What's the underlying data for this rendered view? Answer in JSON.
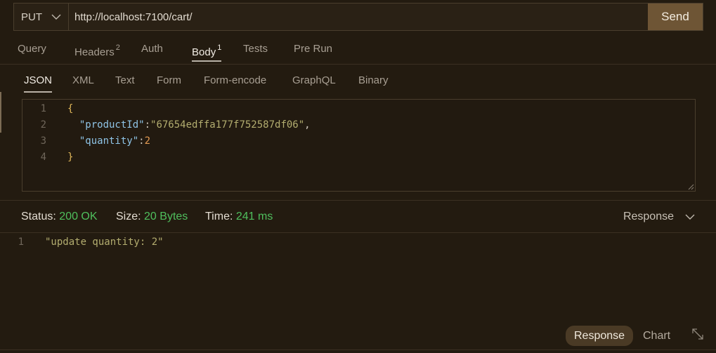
{
  "request": {
    "method": "PUT",
    "url": "http://localhost:7100/cart/",
    "send_label": "Send"
  },
  "request_tabs": [
    {
      "label": "Query",
      "badge": ""
    },
    {
      "label": "Headers",
      "badge": "2"
    },
    {
      "label": "Auth",
      "badge": ""
    },
    {
      "label": "Body",
      "badge": "1"
    },
    {
      "label": "Tests",
      "badge": ""
    },
    {
      "label": "Pre Run",
      "badge": ""
    }
  ],
  "active_request_tab": "Body",
  "body_tabs": [
    "JSON",
    "XML",
    "Text",
    "Form",
    "Form-encode",
    "GraphQL",
    "Binary"
  ],
  "active_body_tab": "JSON",
  "editor": {
    "line_numbers": [
      "1",
      "2",
      "3",
      "4"
    ],
    "line1": "{",
    "line2_key": "\"productId\"",
    "line2_colon": ":",
    "line2_value": "\"67654edffa177f752587df06\"",
    "line2_comma": ",",
    "line3_key": "\"quantity\"",
    "line3_colon": ":",
    "line3_value": "2",
    "line4": "}"
  },
  "status": {
    "status_label": "Status:",
    "status_value": "200 OK",
    "size_label": "Size:",
    "size_value": "20 Bytes",
    "time_label": "Time:",
    "time_value": "241 ms",
    "view_select": "Response"
  },
  "response": {
    "line_number": "1",
    "text": "\"update quantity: 2\""
  },
  "bottom_tabs": {
    "response": "Response",
    "chart": "Chart"
  },
  "colors": {
    "background": "#231b10",
    "send_button": "#6e5535",
    "status_ok": "#4fbf5d"
  },
  "icons": {
    "method_dropdown": "chevron-down-icon",
    "view_dropdown": "chevron-down-icon",
    "expand": "expand-icon",
    "resize": "resize-grip-icon"
  }
}
